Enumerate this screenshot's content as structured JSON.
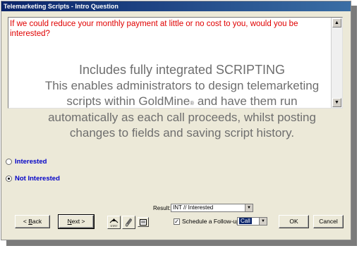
{
  "window": {
    "title": "Telemarketing Scripts - Intro Question"
  },
  "question": {
    "text": "If we could reduce your monthly payment at little or no cost to you, would you be interested?",
    "scroll_up_glyph": "▲",
    "scroll_down_glyph": "▼"
  },
  "overlay": {
    "line1": "Includes fully integrated SCRIPTING",
    "line2": "This enables administrators to design telemarketing",
    "line3_a": "scripts within GoldMine",
    "line3_reg": "®",
    "line3_b": " and have them run",
    "line4": "automatically as each call proceeds, whilst posting",
    "line5": "changes to fields and saving script history."
  },
  "answers": [
    {
      "label": "Interested",
      "checked": false
    },
    {
      "label": "Not Interested",
      "checked": true
    }
  ],
  "result": {
    "label": "Result:",
    "value": "INT // Interested"
  },
  "followup": {
    "checked": true,
    "label": "Schedule a Follow-up:",
    "value": "Call"
  },
  "buttons": {
    "back_u": "B",
    "back_rest": "ack",
    "next_u": "N",
    "next_rest": "ext",
    "ok": "OK",
    "cancel": "Cancel",
    "start_caption": "STRT"
  },
  "colors": {
    "question_text": "#e00000",
    "answer_text": "#0000c8",
    "titlebar": "#0a246a",
    "dialog_bg": "#ece9d8"
  }
}
